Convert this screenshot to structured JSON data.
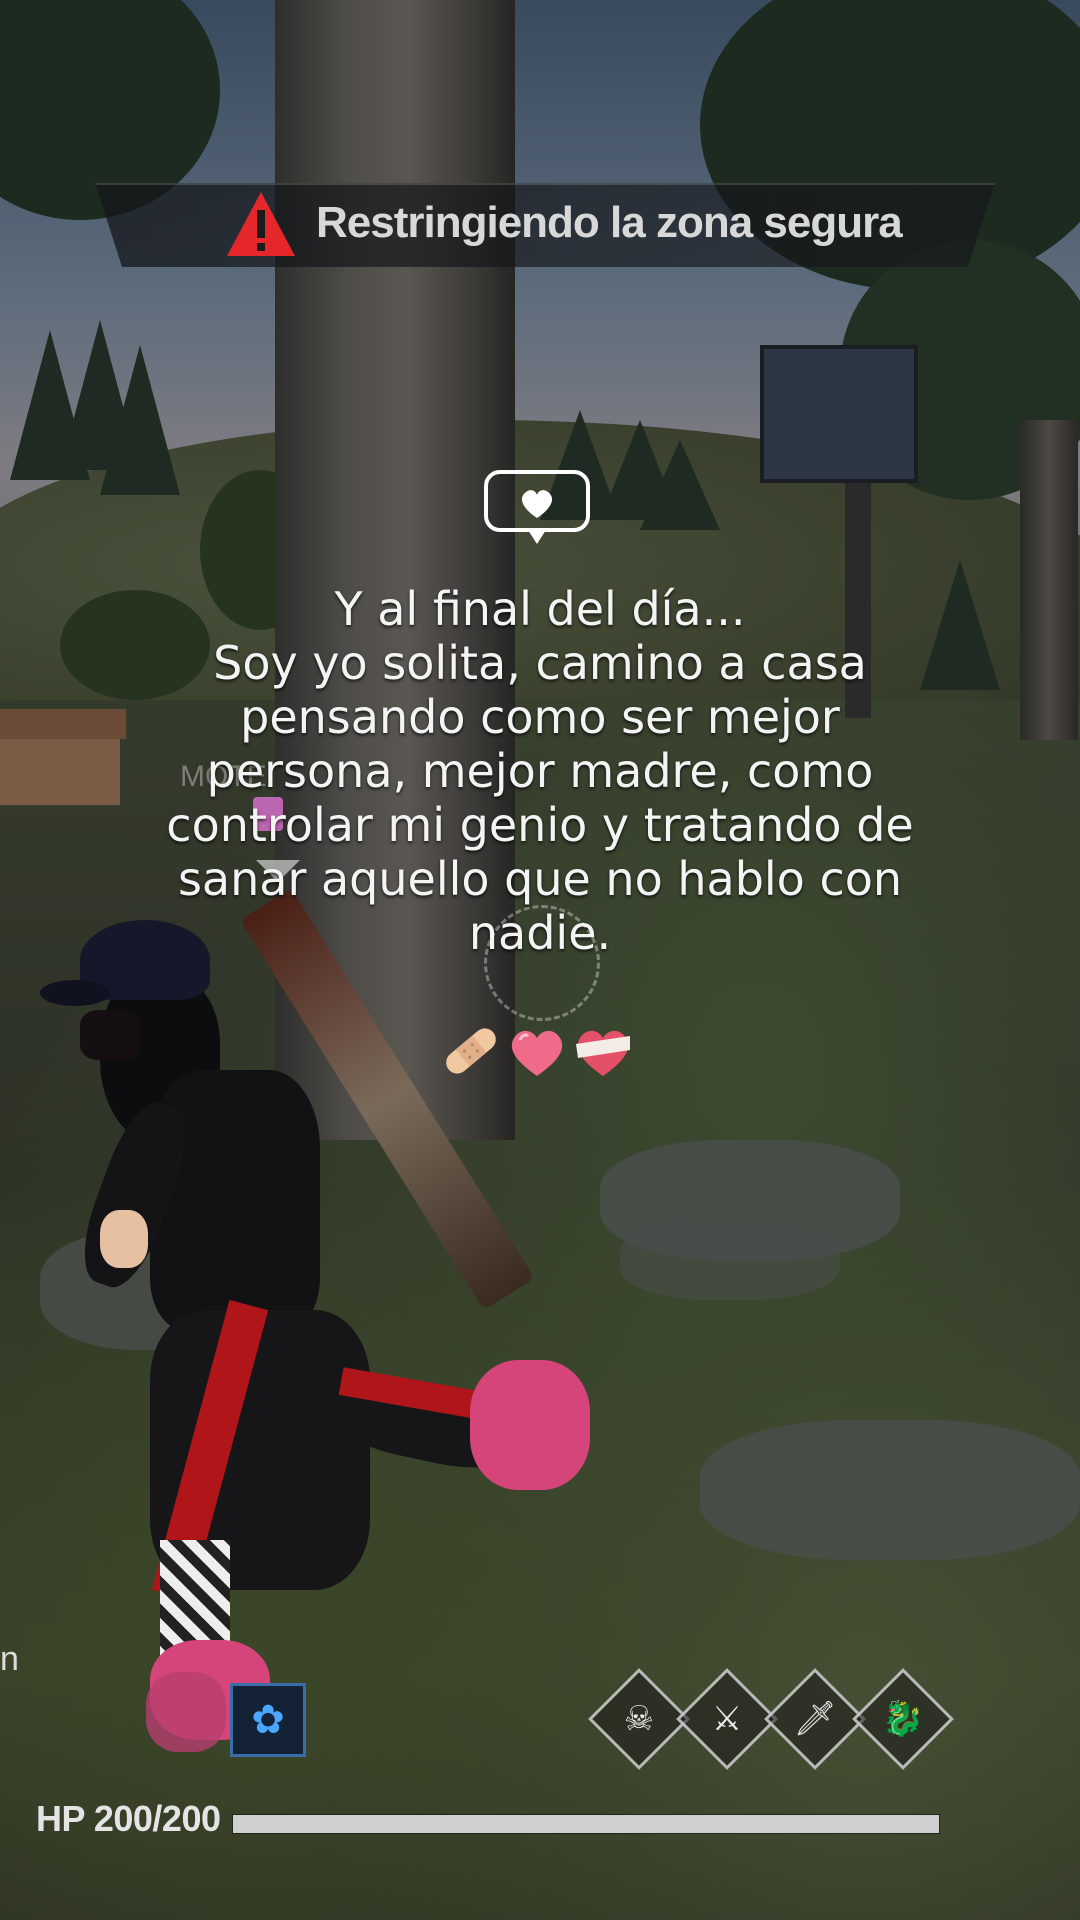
{
  "hud": {
    "zone_banner": {
      "text": "Restringiendo la zona segura",
      "icon": "warning-triangle-icon",
      "icon_color": "#e5262b"
    },
    "player_name_partial": "MOTE",
    "left_edge_letter": "n",
    "health": {
      "label": "HP 200/200",
      "current": 200,
      "max": 200,
      "fraction": 1.0
    },
    "skills": [
      {
        "icon": "skull-skill-icon",
        "glyph": "☠"
      },
      {
        "icon": "crossed-weapons-skill-icon",
        "glyph": "⚔"
      },
      {
        "icon": "dagger-skill-icon",
        "glyph": "🗡"
      },
      {
        "icon": "dragon-skill-icon",
        "glyph": "🐉"
      }
    ],
    "ability_slot": {
      "icon": "ability-icon",
      "glyph": "✿"
    }
  },
  "caption": {
    "icon": "heart-chat-bubble-icon",
    "lines": [
      "Y al final del día...",
      "Soy yo solita, camino a casa",
      "pensando como ser mejor",
      "persona, mejor madre, como",
      "controlar mi genio y tratando de",
      "sanar aquello que no hablo con",
      "nadie."
    ],
    "emojis": [
      "adhesive-bandage-emoji",
      "pink-heart-emoji",
      "bandaged-heart-emoji"
    ]
  },
  "colors": {
    "caption_text": "#f4f4f4",
    "hp_fill": "#cfcfcf",
    "accent_pink": "#d6457a"
  }
}
